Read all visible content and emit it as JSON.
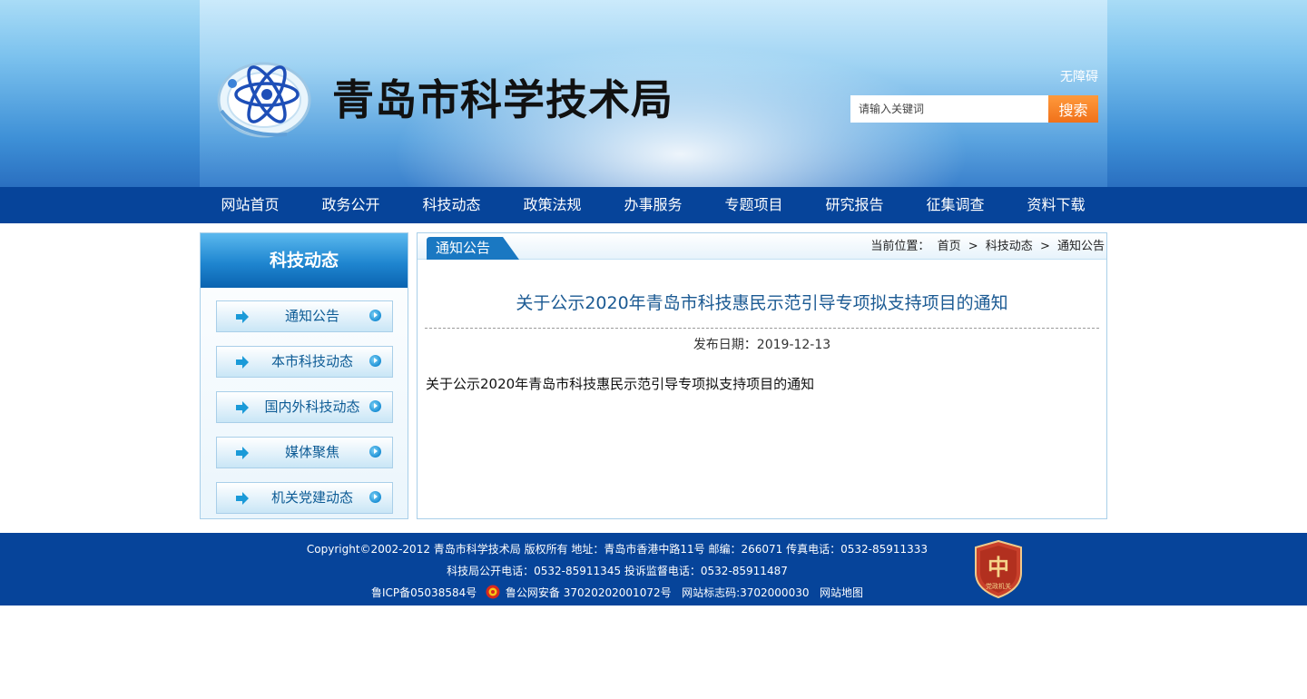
{
  "header": {
    "site_title": "青岛市科学技术局",
    "accessible_link": "无障碍",
    "search_placeholder": "请输入关键词",
    "search_button": "搜索"
  },
  "nav": {
    "items": [
      "网站首页",
      "政务公开",
      "科技动态",
      "政策法规",
      "办事服务",
      "专题项目",
      "研究报告",
      "征集调查",
      "资料下载"
    ]
  },
  "sidebar": {
    "title": "科技动态",
    "items": [
      "通知公告",
      "本市科技动态",
      "国内外科技动态",
      "媒体聚焦",
      "机关党建动态"
    ]
  },
  "main": {
    "tab_label": "通知公告",
    "breadcrumb": {
      "prefix": "当前位置：",
      "items": [
        "首页",
        "科技动态",
        "通知公告"
      ],
      "separator": ">"
    },
    "article_title": "关于公示2020年青岛市科技惠民示范引导专项拟支持项目的通知",
    "publish_date": "发布日期：2019-12-13",
    "body_text": "关于公示2020年青岛市科技惠民示范引导专项拟支持项目的通知"
  },
  "footer": {
    "line1": "Copyright©2002-2012 青岛市科学技术局 版权所有 地址：青岛市香港中路11号 邮编：266071 传真电话：0532-85911333",
    "line2": "科技局公开电话：0532-85911345 投诉监督电话：0532-85911487",
    "icp": "鲁ICP备05038584号",
    "police": "鲁公网安备 37020202001072号",
    "site_code": "网站标志码:3702000030",
    "sitemap": "网站地图",
    "badge_text": "党政机关"
  },
  "colors": {
    "nav_bg": "#06449a",
    "search_button": "#f0711a",
    "title_text": "#1b5a93",
    "sidebar_title": "#1f86d0"
  }
}
